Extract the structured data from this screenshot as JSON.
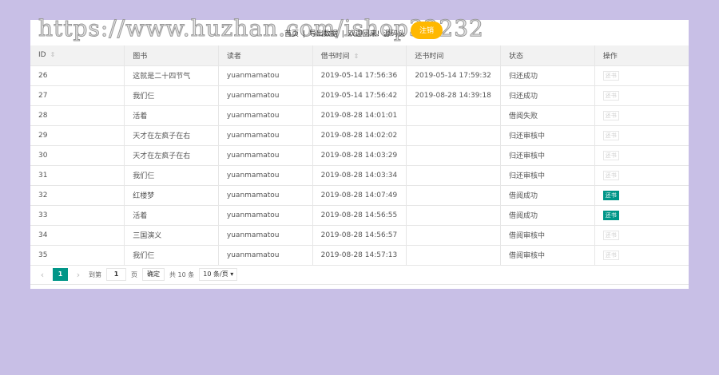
{
  "watermark": "https://www.huzhan.com/ishop32232",
  "nav": {
    "home": "首页",
    "sep": "|",
    "export": "导出数据",
    "sep2": "|",
    "welcome": "欢迎回来!",
    "user": "源码头",
    "logout": "注销"
  },
  "columns": [
    "ID",
    "图书",
    "读者",
    "借书时间",
    "还书时间",
    "状态",
    "操作"
  ],
  "rows": [
    {
      "id": "26",
      "book": "这就是二十四节气",
      "reader": "yuanmamatou",
      "borrow": "2019-05-14 17:56:36",
      "return": "2019-05-14 17:59:32",
      "status": "归还成功",
      "action": "还书",
      "enabled": false
    },
    {
      "id": "27",
      "book": "我们仨",
      "reader": "yuanmamatou",
      "borrow": "2019-05-14 17:56:42",
      "return": "2019-08-28 14:39:18",
      "status": "归还成功",
      "action": "还书",
      "enabled": false
    },
    {
      "id": "28",
      "book": "活着",
      "reader": "yuanmamatou",
      "borrow": "2019-08-28 14:01:01",
      "return": "",
      "status": "借阅失败",
      "action": "还书",
      "enabled": false
    },
    {
      "id": "29",
      "book": "天才在左疯子在右",
      "reader": "yuanmamatou",
      "borrow": "2019-08-28 14:02:02",
      "return": "",
      "status": "归还审核中",
      "action": "还书",
      "enabled": false
    },
    {
      "id": "30",
      "book": "天才在左疯子在右",
      "reader": "yuanmamatou",
      "borrow": "2019-08-28 14:03:29",
      "return": "",
      "status": "归还审核中",
      "action": "还书",
      "enabled": false
    },
    {
      "id": "31",
      "book": "我们仨",
      "reader": "yuanmamatou",
      "borrow": "2019-08-28 14:03:34",
      "return": "",
      "status": "归还审核中",
      "action": "还书",
      "enabled": false
    },
    {
      "id": "32",
      "book": "红楼梦",
      "reader": "yuanmamatou",
      "borrow": "2019-08-28 14:07:49",
      "return": "",
      "status": "借阅成功",
      "action": "还书",
      "enabled": true
    },
    {
      "id": "33",
      "book": "活着",
      "reader": "yuanmamatou",
      "borrow": "2019-08-28 14:56:55",
      "return": "",
      "status": "借阅成功",
      "action": "还书",
      "enabled": true
    },
    {
      "id": "34",
      "book": "三国演义",
      "reader": "yuanmamatou",
      "borrow": "2019-08-28 14:56:57",
      "return": "",
      "status": "借阅审核中",
      "action": "还书",
      "enabled": false
    },
    {
      "id": "35",
      "book": "我们仨",
      "reader": "yuanmamatou",
      "borrow": "2019-08-28 14:57:13",
      "return": "",
      "status": "借阅审核中",
      "action": "还书",
      "enabled": false
    }
  ],
  "pager": {
    "prev": "‹",
    "current": "1",
    "next": "›",
    "goto": "到第",
    "page_value": "1",
    "page_unit": "页",
    "confirm": "确定",
    "total": "共 10 条",
    "per_page": "10 条/页"
  }
}
